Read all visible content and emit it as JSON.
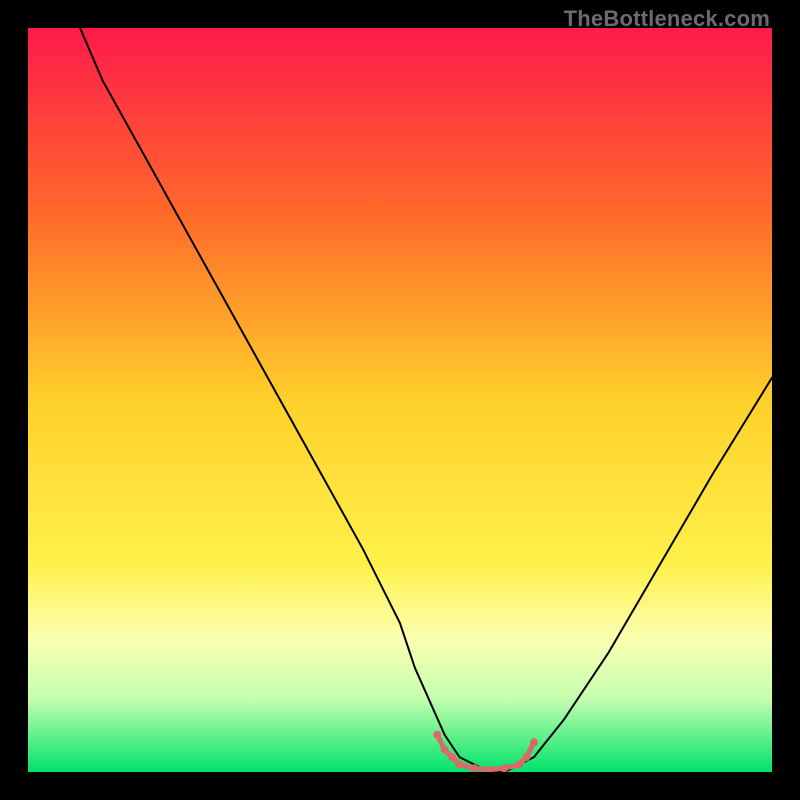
{
  "watermark": "TheBottleneck.com",
  "chart_data": {
    "type": "line",
    "title": "",
    "xlabel": "",
    "ylabel": "",
    "xlim": [
      0,
      100
    ],
    "ylim": [
      0,
      100
    ],
    "grid": false,
    "background_gradient": {
      "stops": [
        {
          "offset": 0,
          "color": "#ff1a4b"
        },
        {
          "offset": 25,
          "color": "#ff6a2a"
        },
        {
          "offset": 50,
          "color": "#ffd02a"
        },
        {
          "offset": 72,
          "color": "#fff14a"
        },
        {
          "offset": 82,
          "color": "#fbffb0"
        },
        {
          "offset": 90,
          "color": "#c7ffb0"
        },
        {
          "offset": 100,
          "color": "#00e36a"
        }
      ]
    },
    "series": [
      {
        "name": "bottleneck-curve",
        "stroke": "#000000",
        "stroke_width": 2,
        "x": [
          7,
          10,
          15,
          20,
          25,
          30,
          35,
          40,
          45,
          50,
          52,
          56,
          58,
          62,
          64,
          68,
          72,
          78,
          85,
          92,
          100
        ],
        "values": [
          100,
          93,
          84,
          75,
          66,
          57,
          48,
          39,
          30,
          20,
          14,
          5,
          2,
          0,
          0,
          2,
          7,
          16,
          28,
          40,
          53
        ]
      },
      {
        "name": "optimal-band",
        "stroke": "#d86a6a",
        "stroke_width": 5,
        "markers": true,
        "marker_radius": 4,
        "x": [
          55,
          56,
          57,
          58,
          60,
          62,
          64,
          66,
          67,
          68
        ],
        "values": [
          5,
          3,
          2,
          1,
          0.5,
          0.3,
          0.5,
          1,
          2,
          4
        ]
      }
    ]
  }
}
